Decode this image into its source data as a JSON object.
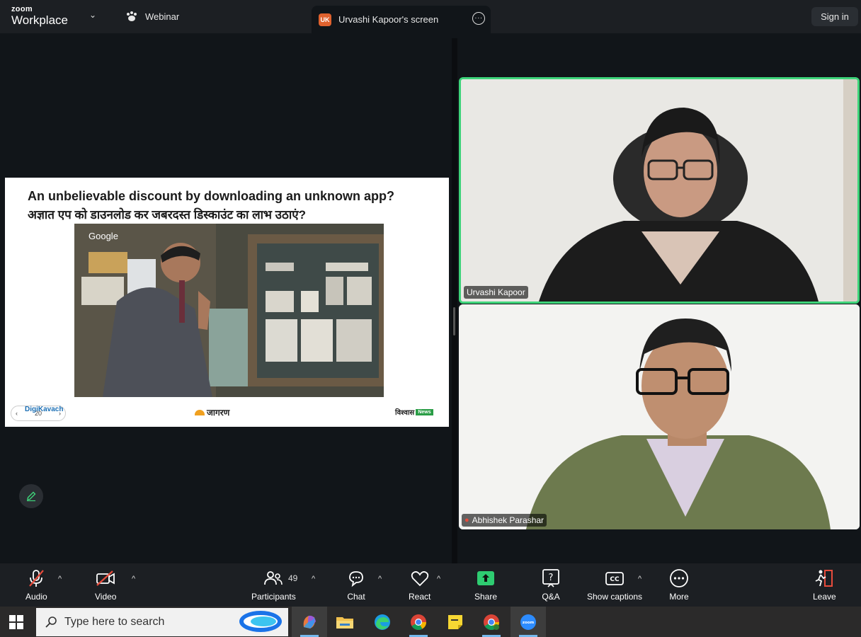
{
  "topbar": {
    "logo_small": "zoom",
    "logo_big": "Workplace",
    "menu_label": "Webinar",
    "screen_tab_initials": "UK",
    "screen_tab_label": "Urvashi Kapoor's screen",
    "sign_in": "Sign in"
  },
  "slide": {
    "title_en": "An unbelievable discount by downloading an unknown app?",
    "title_hi": "अज्ञात एप को डाउनलोड कर जबरदस्त डिस्काउंट का लाभ उठाएं?",
    "image_tag": "Google",
    "page_number": "20",
    "logo_left": "DigiKavach",
    "logo_center": "जागरण",
    "logo_right": "विश्वास",
    "logo_right_tag": "News"
  },
  "participants_video": [
    {
      "name": "Urvashi Kapoor",
      "muted": false,
      "active_speaker": true
    },
    {
      "name": "Abhishek Parashar",
      "muted": true,
      "active_speaker": false
    }
  ],
  "toolbar": {
    "audio": "Audio",
    "video": "Video",
    "participants": "Participants",
    "participants_count": "49",
    "chat": "Chat",
    "react": "React",
    "share": "Share",
    "qa": "Q&A",
    "captions": "Show captions",
    "more": "More",
    "leave": "Leave"
  },
  "taskbar": {
    "search_placeholder": "Type here to search",
    "apps": [
      "copilot",
      "file-explorer",
      "edge",
      "chrome",
      "sticky-notes",
      "chrome-profile",
      "zoom"
    ]
  },
  "colors": {
    "active_speaker_border": "#3ed47a",
    "share_green": "#2ecc71",
    "leave_red": "#e74c3c"
  }
}
